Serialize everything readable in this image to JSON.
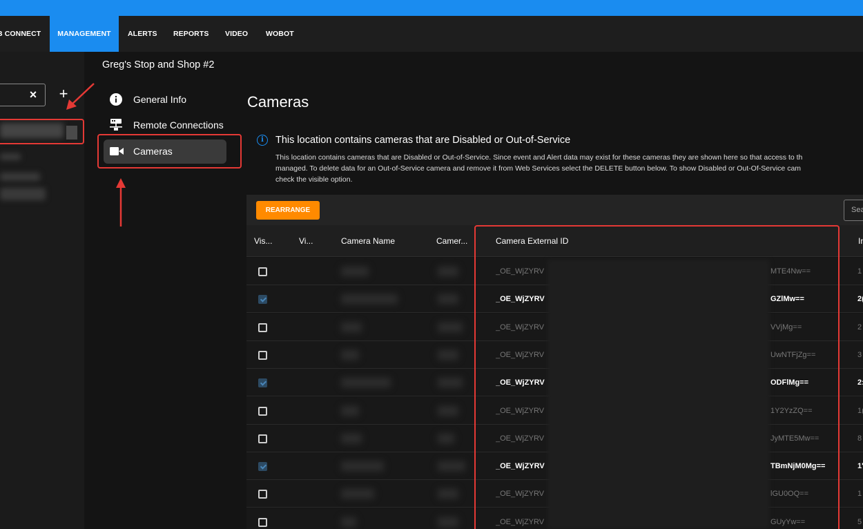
{
  "nav": {
    "items": [
      {
        "label": "B CONNECT"
      },
      {
        "label": "MANAGEMENT",
        "active": true
      },
      {
        "label": "ALERTS"
      },
      {
        "label": "REPORTS"
      },
      {
        "label": "VIDEO"
      },
      {
        "label": "WOBOT"
      }
    ]
  },
  "sidebar": {
    "clear_icon": "×",
    "add_icon": "+"
  },
  "location": {
    "title": "Greg's Stop and Shop #2",
    "menu": [
      {
        "label": "General Info",
        "icon": "info-icon"
      },
      {
        "label": "Remote Connections",
        "icon": "network-icon"
      },
      {
        "label": "Cameras",
        "icon": "camera-icon",
        "active": true
      }
    ]
  },
  "main": {
    "title": "Cameras",
    "notice": {
      "icon_glyph": "i",
      "title": "This location contains cameras that are Disabled or Out-of-Service",
      "lines": [
        "This location contains cameras that are Disabled or Out-of-Service. Since event and Alert data may exist for these cameras they are shown here so that access to th",
        "managed. To delete data for an Out-of-Service camera and remove it from Web Services select the DELETE button below. To show Disabled or Out-Of-Service cam",
        "check the visible option."
      ]
    },
    "toolbar": {
      "rearrange_label": "REARRANGE",
      "search_placeholder": "Sea"
    },
    "table": {
      "headers": [
        "Vis...",
        "Vi...",
        "Camera Name",
        "Camer...",
        "Camera External ID",
        "In"
      ],
      "rows": [
        {
          "checked": false,
          "id_prefix": "_OE_WjZYRV",
          "id_suffix": "MTE4Nw==",
          "last": "1",
          "bright": false
        },
        {
          "checked": true,
          "id_prefix": "_OE_WjZYRV",
          "id_suffix": "GZlMw==",
          "last": "2(",
          "bright": true
        },
        {
          "checked": false,
          "id_prefix": "_OE_WjZYRV",
          "id_suffix": "VVjMg==",
          "last": "2",
          "bright": false
        },
        {
          "checked": false,
          "id_prefix": "_OE_WjZYRV",
          "id_suffix": "UwNTFjZg==",
          "last": "3",
          "bright": false
        },
        {
          "checked": true,
          "id_prefix": "_OE_WjZYRV",
          "id_suffix": "ODFlMg==",
          "last": "2:",
          "bright": true
        },
        {
          "checked": false,
          "id_prefix": "_OE_WjZYRV",
          "id_suffix": "1Y2YzZQ==",
          "last": "1(",
          "bright": false
        },
        {
          "checked": false,
          "id_prefix": "_OE_WjZYRV",
          "id_suffix": "JyMTE5Mw==",
          "last": "8",
          "bright": false
        },
        {
          "checked": true,
          "id_prefix": "_OE_WjZYRV",
          "id_suffix": "TBmNjM0Mg==",
          "last": "1'",
          "bright": true
        },
        {
          "checked": false,
          "id_prefix": "_OE_WjZYRV",
          "id_suffix": "lGU0OQ==",
          "last": "1",
          "bright": false
        },
        {
          "checked": false,
          "id_prefix": "_OE_WjZYRV",
          "id_suffix": "GUyYw==",
          "last": "5",
          "bright": false
        }
      ]
    }
  },
  "colors": {
    "accent": "#1a8cf0",
    "button": "#ff8a00",
    "annotation": "#e53935"
  }
}
